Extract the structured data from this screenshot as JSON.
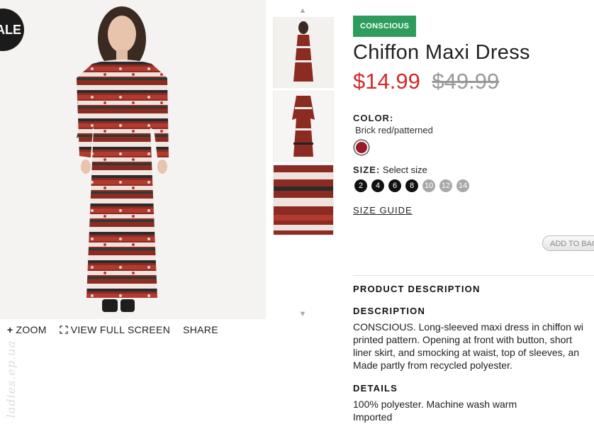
{
  "badges": {
    "sale": "ALE",
    "conscious": "CONSCIOUS"
  },
  "product": {
    "title": "Chiffon Maxi Dress",
    "price_now": "$14.99",
    "price_old": "$49.99"
  },
  "color": {
    "label": "COLOR:",
    "value": "Brick red/patterned",
    "swatch_hex": "#9b1b2a"
  },
  "size": {
    "label": "SIZE:",
    "prompt": "Select size",
    "options": [
      "2",
      "4",
      "6",
      "8",
      "10",
      "12",
      "14"
    ],
    "guide": "SIZE GUIDE"
  },
  "actions": {
    "add_to_bag": "ADD TO BAG"
  },
  "image_tools": {
    "zoom": "ZOOM",
    "fullscreen": "VIEW FULL SCREEN",
    "share": "SHARE"
  },
  "watermark": "ladies.ep.ua",
  "description": {
    "section_title": "PRODUCT DESCRIPTION",
    "desc_heading": "DESCRIPTION",
    "desc_lines": [
      "CONSCIOUS. Long-sleeved maxi dress in chiffon wi",
      "printed pattern. Opening at front with button, short",
      "liner skirt, and smocking at waist, top of sleeves, an",
      "Made partly from recycled polyester."
    ],
    "details_heading": "DETAILS",
    "details_lines": [
      "100% polyester. Machine wash warm",
      "Imported"
    ]
  }
}
